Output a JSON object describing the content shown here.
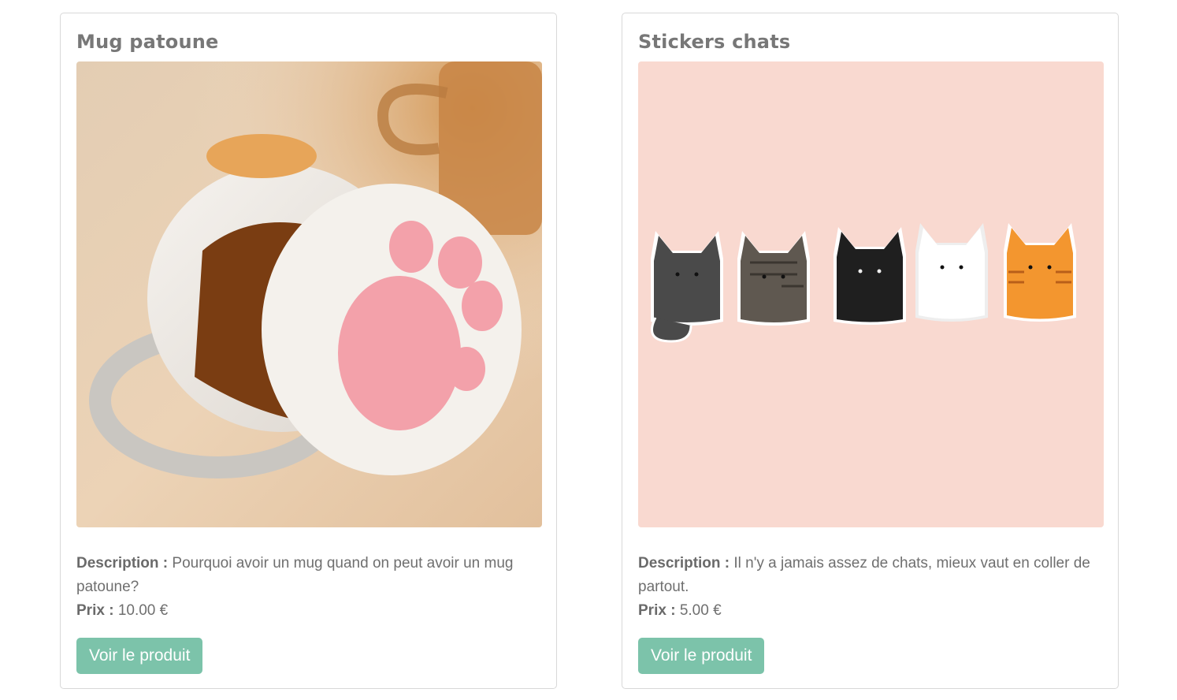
{
  "products": [
    {
      "title": "Mug patoune",
      "image_alt": "cat-paw-mug-photo",
      "description_label": "Description :",
      "description": "Pourquoi avoir un mug quand on peut avoir un mug patoune?",
      "price_label": "Prix :",
      "price": "10.00 €",
      "button_label": "Voir le produit"
    },
    {
      "title": "Stickers chats",
      "image_alt": "cat-stickers-illustration",
      "description_label": "Description :",
      "description": "Il n'y a jamais assez de chats, mieux vaut en coller de partout.",
      "price_label": "Prix :",
      "price": "5.00 €",
      "button_label": "Voir le produit"
    }
  ],
  "colors": {
    "button_bg": "#7cc3aa",
    "title": "#777777",
    "text": "#6f6f6f",
    "sticker_bg": "#f9d9d0"
  }
}
